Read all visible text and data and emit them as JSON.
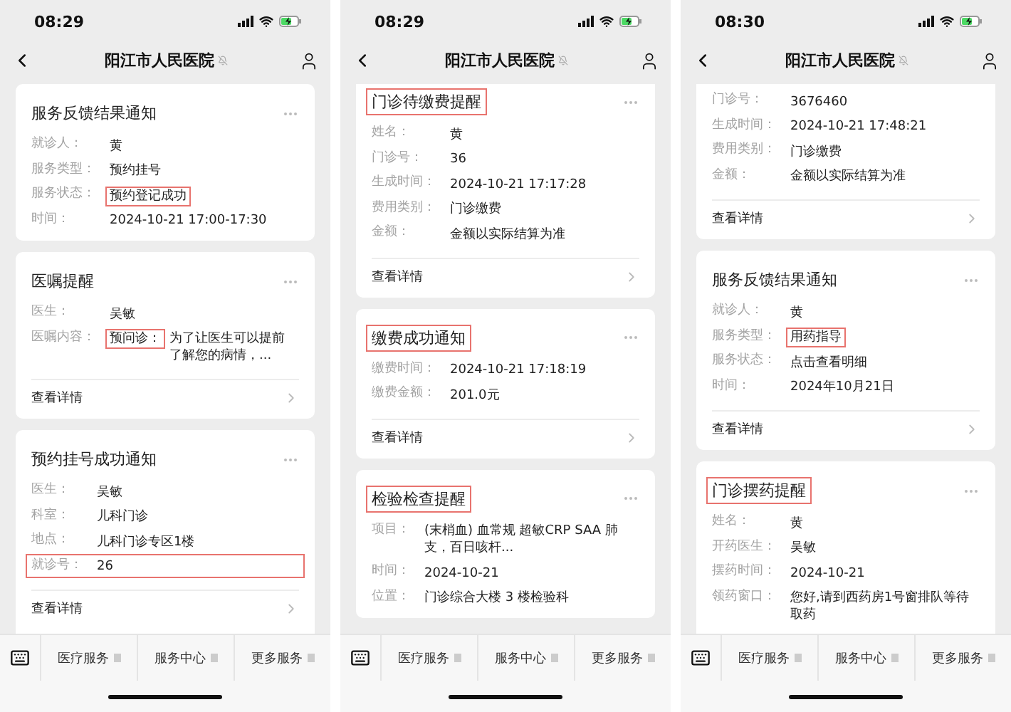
{
  "panels": [
    {
      "status_bar": {
        "time": "08:29"
      },
      "nav": {
        "title": "阳江市人民医院"
      },
      "cards": [
        {
          "title": "服务反馈结果通知",
          "title_highlighted": false,
          "cut_top": false,
          "cut_bottom": false,
          "fields": [
            {
              "label": "就诊人：",
              "row_highlighted": false,
              "value_highlighted": false,
              "value": "黄"
            },
            {
              "label": "服务类型：",
              "row_highlighted": false,
              "value_highlighted": false,
              "value": "预约挂号"
            },
            {
              "label": "服务状态：",
              "row_highlighted": false,
              "value_highlighted": true,
              "value": "预约登记成功"
            },
            {
              "label": "时间：",
              "row_highlighted": false,
              "value_highlighted": false,
              "value": "2024-10-21 17:00-17:30"
            }
          ]
        },
        {
          "title": "医嘱提醒",
          "title_highlighted": false,
          "cut_top": false,
          "cut_bottom": false,
          "fields": [
            {
              "label": "医生：",
              "row_highlighted": false,
              "value_highlighted": false,
              "value": "吴敏"
            },
            {
              "label": "医嘱内容：",
              "row_highlighted": false,
              "value_highlighted": false,
              "prefix": {
                "text": "预问诊：",
                "highlighted": true
              },
              "value": "为了让医生可以提前了解您的病情，..."
            }
          ],
          "footer": "查看详情"
        },
        {
          "title": "预约挂号成功通知",
          "title_highlighted": false,
          "cut_top": false,
          "cut_bottom": true,
          "fields": [
            {
              "label": "医生：",
              "row_highlighted": false,
              "value_highlighted": false,
              "value": "吴敏"
            },
            {
              "label": "科室：",
              "row_highlighted": false,
              "value_highlighted": false,
              "value": "儿科门诊"
            },
            {
              "label": "地点：",
              "row_highlighted": false,
              "value_highlighted": false,
              "value": "儿科门诊专区1楼"
            },
            {
              "label": "就诊号：",
              "row_highlighted": true,
              "value_highlighted": false,
              "value": "26"
            }
          ],
          "footer": "查看详情"
        }
      ],
      "menu": [
        {
          "label": "医疗服务"
        },
        {
          "label": "服务中心"
        },
        {
          "label": "更多服务"
        }
      ]
    },
    {
      "status_bar": {
        "time": "08:29"
      },
      "nav": {
        "title": "阳江市人民医院"
      },
      "cards": [
        {
          "title": "门诊待缴费提醒",
          "title_highlighted": true,
          "cut_top": true,
          "cut_bottom": false,
          "fields": [
            {
              "label": "姓名：",
              "row_highlighted": false,
              "value_highlighted": false,
              "value": "黄"
            },
            {
              "label": "门诊号：",
              "row_highlighted": false,
              "value_highlighted": false,
              "value": "36"
            },
            {
              "label": "生成时间：",
              "row_highlighted": false,
              "value_highlighted": false,
              "value": "2024-10-21 17:17:28"
            },
            {
              "label": "费用类别：",
              "row_highlighted": false,
              "value_highlighted": false,
              "value": "门诊缴费"
            },
            {
              "label": "金额：",
              "row_highlighted": false,
              "value_highlighted": false,
              "value": "金额以实际结算为准"
            }
          ],
          "footer": "查看详情"
        },
        {
          "title": "缴费成功通知",
          "title_highlighted": true,
          "cut_top": false,
          "cut_bottom": false,
          "fields": [
            {
              "label": "缴费时间：",
              "row_highlighted": false,
              "value_highlighted": false,
              "value": "2024-10-21 17:18:19"
            },
            {
              "label": "缴费金额：",
              "row_highlighted": false,
              "value_highlighted": false,
              "value": "201.0元"
            }
          ],
          "footer": "查看详情"
        },
        {
          "title": "检验检查提醒",
          "title_highlighted": true,
          "cut_top": false,
          "cut_bottom": false,
          "fields": [
            {
              "label": "项目：",
              "row_highlighted": false,
              "value_highlighted": false,
              "value": "(末梢血) 血常规 超敏CRP SAA 肺支，百日咳杆..."
            },
            {
              "label": "时间：",
              "row_highlighted": false,
              "value_highlighted": false,
              "value": "2024-10-21"
            },
            {
              "label": "位置：",
              "row_highlighted": false,
              "value_highlighted": false,
              "value": "门诊综合大楼 3 楼检验科"
            }
          ]
        }
      ],
      "menu": [
        {
          "label": "医疗服务"
        },
        {
          "label": "服务中心"
        },
        {
          "label": "更多服务"
        }
      ]
    },
    {
      "status_bar": {
        "time": "08:30"
      },
      "nav": {
        "title": "阳江市人民医院"
      },
      "cards": [
        {
          "cut_top": true,
          "cut_bottom": false,
          "fields": [
            {
              "label": "门诊号：",
              "row_highlighted": false,
              "value_highlighted": false,
              "value": "3676460"
            },
            {
              "label": "生成时间：",
              "row_highlighted": false,
              "value_highlighted": false,
              "value": "2024-10-21 17:48:21"
            },
            {
              "label": "费用类别：",
              "row_highlighted": false,
              "value_highlighted": false,
              "value": "门诊缴费"
            },
            {
              "label": "金额：",
              "row_highlighted": false,
              "value_highlighted": false,
              "value": "金额以实际结算为准"
            }
          ],
          "footer": "查看详情"
        },
        {
          "title": "服务反馈结果通知",
          "title_highlighted": false,
          "cut_top": false,
          "cut_bottom": false,
          "fields": [
            {
              "label": "就诊人：",
              "row_highlighted": false,
              "value_highlighted": false,
              "value": "黄"
            },
            {
              "label": "服务类型：",
              "row_highlighted": false,
              "value_highlighted": true,
              "value": "用药指导"
            },
            {
              "label": "服务状态：",
              "row_highlighted": false,
              "value_highlighted": false,
              "value": "点击查看明细"
            },
            {
              "label": "时间：",
              "row_highlighted": false,
              "value_highlighted": false,
              "value": "2024年10月21日"
            }
          ],
          "footer": "查看详情"
        },
        {
          "title": "门诊摆药提醒",
          "title_highlighted": true,
          "cut_top": false,
          "cut_bottom": true,
          "fields": [
            {
              "label": "姓名：",
              "row_highlighted": false,
              "value_highlighted": false,
              "value": "黄"
            },
            {
              "label": "开药医生：",
              "row_highlighted": false,
              "value_highlighted": false,
              "value": "吴敏"
            },
            {
              "label": "摆药时间：",
              "row_highlighted": false,
              "value_highlighted": false,
              "value": "2024-10-21"
            },
            {
              "label": "领药窗口：",
              "row_highlighted": false,
              "value_highlighted": false,
              "value": "您好,请到西药房1号窗排队等待取药"
            }
          ]
        }
      ],
      "menu": [
        {
          "label": "医疗服务"
        },
        {
          "label": "服务中心"
        },
        {
          "label": "更多服务"
        }
      ]
    }
  ]
}
